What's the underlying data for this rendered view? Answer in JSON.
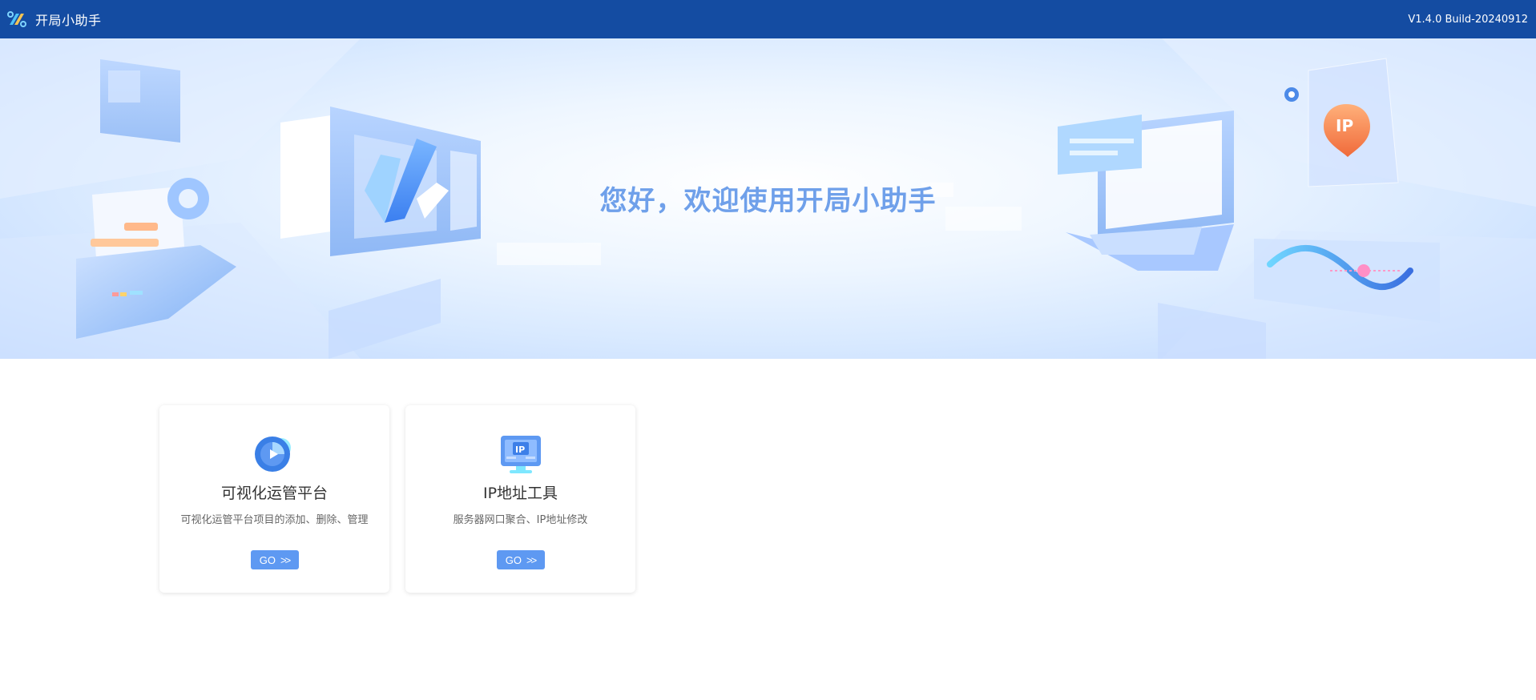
{
  "header": {
    "app_title": "开局小助手",
    "version": "V1.4.0 Build-20240912",
    "logo_icon": "app-logo-icon"
  },
  "banner": {
    "welcome_text": "您好，欢迎使用开局小助手"
  },
  "cards": [
    {
      "title": "可视化运管平台",
      "description": "可视化运管平台项目的添加、删除、管理",
      "button_label": "GO",
      "button_arrow": ">>",
      "icon": "dashboard-pie-icon"
    },
    {
      "title": "IP地址工具",
      "description": "服务器网口聚合、IP地址修改",
      "button_label": "GO",
      "button_arrow": ">>",
      "icon": "ip-monitor-icon",
      "icon_text": "IP"
    }
  ],
  "colors": {
    "header_bg": "#144ca2",
    "accent": "#5e99f2",
    "welcome_text": "#6fa0ea"
  }
}
